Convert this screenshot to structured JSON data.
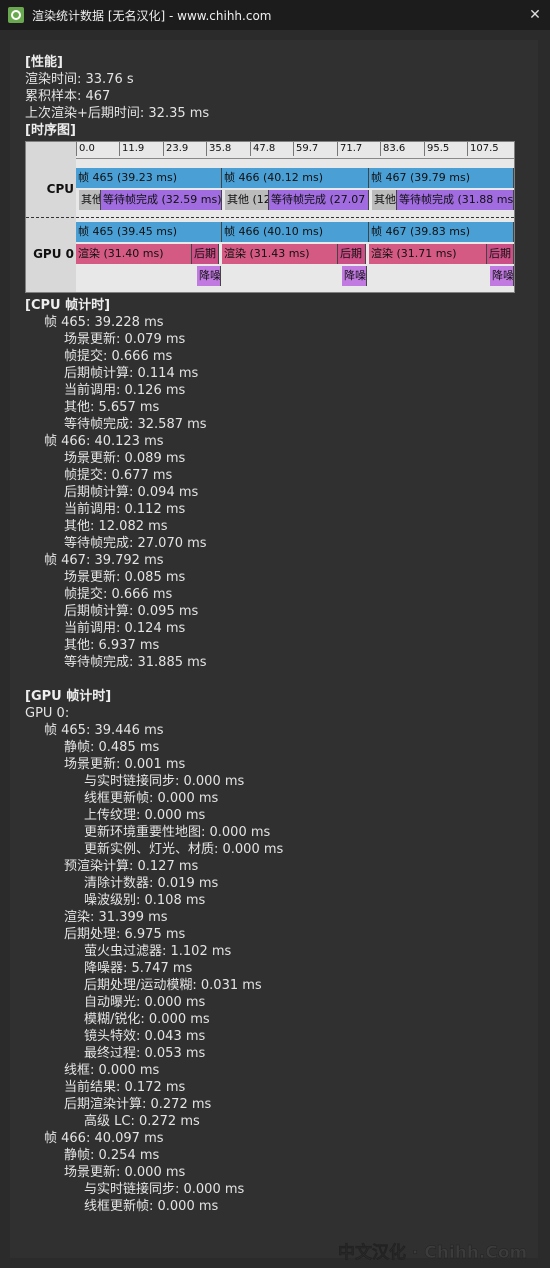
{
  "window": {
    "title": "渲染统计数据 [无名汉化] - www.chihh.com",
    "close_glyph": "✕",
    "app_icon": "app-icon"
  },
  "sections": {
    "perf": "[性能]",
    "timeline": "[时序图]",
    "cpu": "[CPU 帧计时]",
    "gpu": "[GPU 帧计时]"
  },
  "perf": [
    "渲染时间: 33.76 s",
    "累积样本: 467",
    "上次渲染+后期时间: 32.35 ms"
  ],
  "timeline": {
    "ticks": [
      "0.0",
      "11.9",
      "23.9",
      "35.8",
      "47.8",
      "59.7",
      "71.7",
      "83.6",
      "95.5",
      "107.5"
    ],
    "cpu_label": "CPU",
    "gpu_label": "GPU 0",
    "cpu_frames": [
      "帧 465 (39.23 ms)",
      "帧 466 (40.12 ms)",
      "帧 467 (39.79 ms)"
    ],
    "cpu_sub": [
      "其他",
      "等待帧完成 (32.59 ms)",
      "其他 (12",
      "等待帧完成 (27.07",
      "其他",
      "等待帧完成 (31.88 ms"
    ],
    "gpu_frames": [
      "帧 465 (39.45 ms)",
      "帧 466 (40.10 ms)",
      "帧 467 (39.83 ms)"
    ],
    "gpu_render": [
      "渲染 (31.40 ms)",
      "后期",
      "渲染 (31.43 ms)",
      "后期",
      "渲染 (31.71 ms)",
      "后期"
    ],
    "gpu_denoise": [
      "降噪",
      "降噪",
      "降噪"
    ]
  },
  "cpu_rows": [
    {
      "t": "帧 465: 39.228 ms",
      "l": 1
    },
    {
      "t": "场景更新: 0.079 ms",
      "l": 2
    },
    {
      "t": "帧提交: 0.666 ms",
      "l": 2
    },
    {
      "t": "后期帧计算: 0.114 ms",
      "l": 2
    },
    {
      "t": "当前调用: 0.126 ms",
      "l": 2
    },
    {
      "t": "其他: 5.657 ms",
      "l": 2
    },
    {
      "t": "等待帧完成: 32.587 ms",
      "l": 2
    },
    {
      "t": "帧 466: 40.123 ms",
      "l": 1
    },
    {
      "t": "场景更新: 0.089 ms",
      "l": 2
    },
    {
      "t": "帧提交: 0.677 ms",
      "l": 2
    },
    {
      "t": "后期帧计算: 0.094 ms",
      "l": 2
    },
    {
      "t": "当前调用: 0.112 ms",
      "l": 2
    },
    {
      "t": "其他: 12.082 ms",
      "l": 2
    },
    {
      "t": "等待帧完成: 27.070 ms",
      "l": 2
    },
    {
      "t": "帧 467: 39.792 ms",
      "l": 1
    },
    {
      "t": "场景更新: 0.085 ms",
      "l": 2
    },
    {
      "t": "帧提交: 0.666 ms",
      "l": 2
    },
    {
      "t": "后期帧计算: 0.095 ms",
      "l": 2
    },
    {
      "t": "当前调用: 0.124 ms",
      "l": 2
    },
    {
      "t": "其他: 6.937 ms",
      "l": 2
    },
    {
      "t": "等待帧完成: 31.885 ms",
      "l": 2
    }
  ],
  "gpu_rows": [
    {
      "t": "GPU 0:",
      "l": 0
    },
    {
      "t": "帧 465: 39.446 ms",
      "l": 1
    },
    {
      "t": "静帧: 0.485 ms",
      "l": 2
    },
    {
      "t": "场景更新: 0.001 ms",
      "l": 2
    },
    {
      "t": "与实时链接同步: 0.000 ms",
      "l": 3
    },
    {
      "t": "线框更新帧: 0.000 ms",
      "l": 3
    },
    {
      "t": "上传纹理: 0.000 ms",
      "l": 3
    },
    {
      "t": "更新环境重要性地图: 0.000 ms",
      "l": 3
    },
    {
      "t": "更新实例、灯光、材质: 0.000 ms",
      "l": 3
    },
    {
      "t": "预渲染计算: 0.127 ms",
      "l": 2
    },
    {
      "t": "清除计数器: 0.019 ms",
      "l": 3
    },
    {
      "t": "噪波级别: 0.108 ms",
      "l": 3
    },
    {
      "t": "渲染: 31.399 ms",
      "l": 2
    },
    {
      "t": "后期处理: 6.975 ms",
      "l": 2
    },
    {
      "t": "萤火虫过滤器: 1.102 ms",
      "l": 3
    },
    {
      "t": "降噪器: 5.747 ms",
      "l": 3
    },
    {
      "t": "后期处理/运动模糊: 0.031 ms",
      "l": 3
    },
    {
      "t": "自动曝光: 0.000 ms",
      "l": 3
    },
    {
      "t": "模糊/锐化: 0.000 ms",
      "l": 3
    },
    {
      "t": "镜头特效: 0.043 ms",
      "l": 3
    },
    {
      "t": "最终过程: 0.053 ms",
      "l": 3
    },
    {
      "t": "线框: 0.000 ms",
      "l": 2
    },
    {
      "t": "当前结果: 0.172 ms",
      "l": 2
    },
    {
      "t": "后期渲染计算: 0.272 ms",
      "l": 2
    },
    {
      "t": "高级 LC: 0.272 ms",
      "l": 3
    },
    {
      "t": "帧 466: 40.097 ms",
      "l": 1
    },
    {
      "t": "静帧: 0.254 ms",
      "l": 2
    },
    {
      "t": "场景更新: 0.000 ms",
      "l": 2
    },
    {
      "t": "与实时链接同步: 0.000 ms",
      "l": 3
    },
    {
      "t": "线框更新帧: 0.000 ms",
      "l": 3
    }
  ],
  "watermark": "中文汉化 · Chihh.Com",
  "colors": {
    "frame": "#4a9fd4",
    "wait": "#a06ce0",
    "render": "#d45a84",
    "denoise": "#c07ae0"
  }
}
